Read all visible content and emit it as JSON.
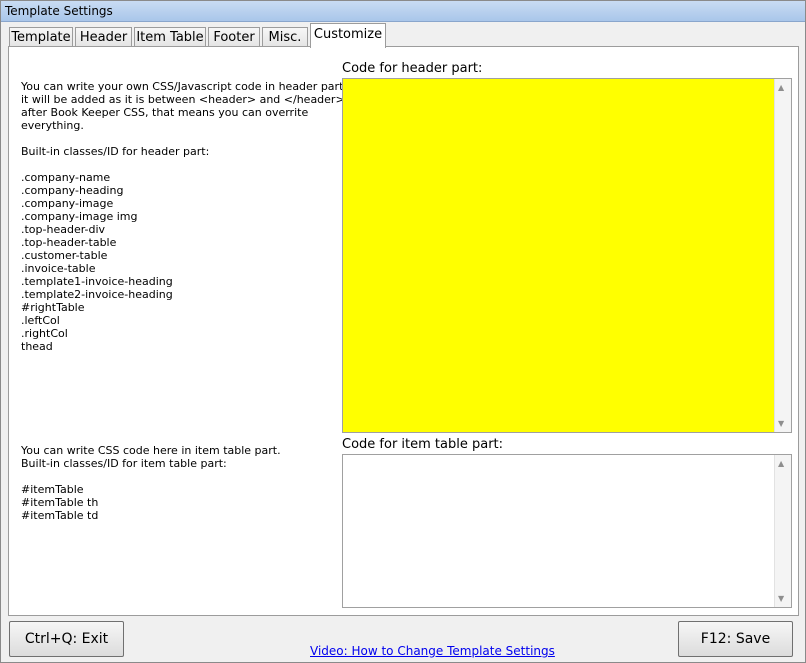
{
  "window": {
    "title": "Template Settings"
  },
  "tabs": [
    {
      "label": "Template"
    },
    {
      "label": "Header"
    },
    {
      "label": "Item Table"
    },
    {
      "label": "Footer"
    },
    {
      "label": "Misc."
    },
    {
      "label": "Customize",
      "active": true
    }
  ],
  "customize": {
    "header_info": "You can write your own CSS/Javascript code in header part,\nit will be added as it is between <header> and </header>\nafter Book Keeper CSS, that means you can overrite\neverything.\n\nBuilt-in classes/ID for header part:\n\n.company-name\n.company-heading\n.company-image\n.company-image img\n.top-header-div\n.top-header-table\n.customer-table\n.invoice-table\n.template1-invoice-heading\n.template2-invoice-heading\n#rightTable\n.leftCol\n.rightCol\nthead",
    "item_info": "You can write CSS code here in item table part.\nBuilt-in classes/ID for item table part:\n\n#itemTable\n#itemTable th\n#itemTable td",
    "header_label": "Code for header part:",
    "item_label": "Code for item table part:",
    "header_code": "",
    "item_code": "",
    "header_bg": "#ffff00"
  },
  "footer": {
    "exit_label": "Ctrl+Q: Exit",
    "save_label": "F12: Save",
    "video_link": "Video: How to Change Template Settings"
  }
}
